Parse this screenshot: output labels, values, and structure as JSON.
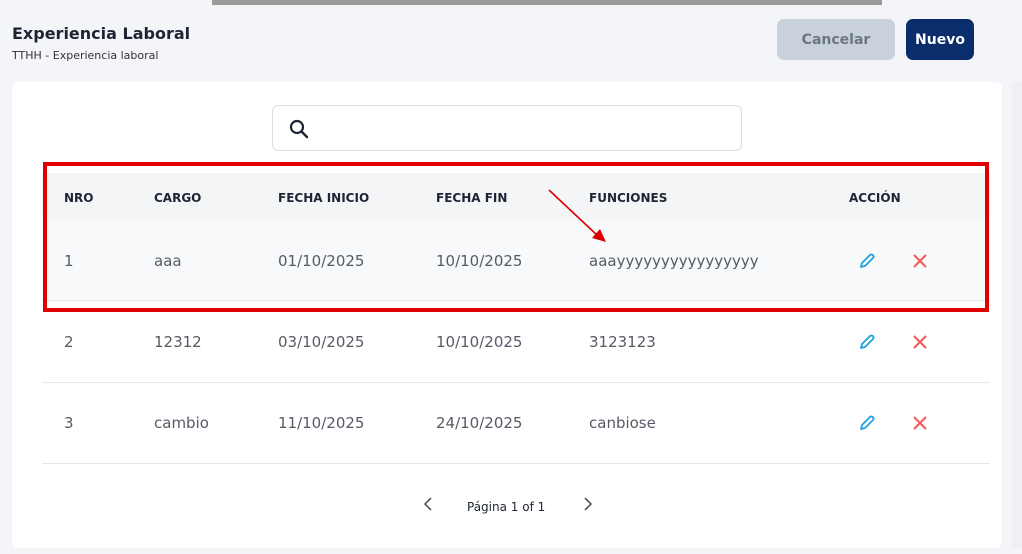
{
  "header": {
    "title": "Experiencia Laboral",
    "breadcrumb": "TTHH  - Experiencia laboral"
  },
  "buttons": {
    "cancel": "Cancelar",
    "new": "Nuevo"
  },
  "search": {
    "placeholder": "",
    "value": ""
  },
  "table": {
    "columns": [
      "NRO",
      "CARGO",
      "FECHA INICIO",
      "FECHA FIN",
      "FUNCIONES",
      "ACCIÓN"
    ],
    "rows": [
      {
        "nro": "1",
        "cargo": "aaa",
        "inicio": "01/10/2025",
        "fin": "10/10/2025",
        "funciones": "aaayyyyyyyyyyyyyyyy"
      },
      {
        "nro": "2",
        "cargo": "12312",
        "inicio": "03/10/2025",
        "fin": "10/10/2025",
        "funciones": "3123123"
      },
      {
        "nro": "3",
        "cargo": "cambio",
        "inicio": "11/10/2025",
        "fin": "24/10/2025",
        "funciones": "canbiose"
      }
    ]
  },
  "pagination": {
    "label": "Página 1 of 1"
  },
  "colors": {
    "primary": "#0b2d6b",
    "edit": "#1fa3e0",
    "delete": "#f05a5a",
    "highlight": "#e00000"
  },
  "icons": {
    "search": "search-icon",
    "edit": "pencil-icon",
    "delete": "close-icon",
    "prev": "chevron-left-icon",
    "next": "chevron-right-icon"
  }
}
